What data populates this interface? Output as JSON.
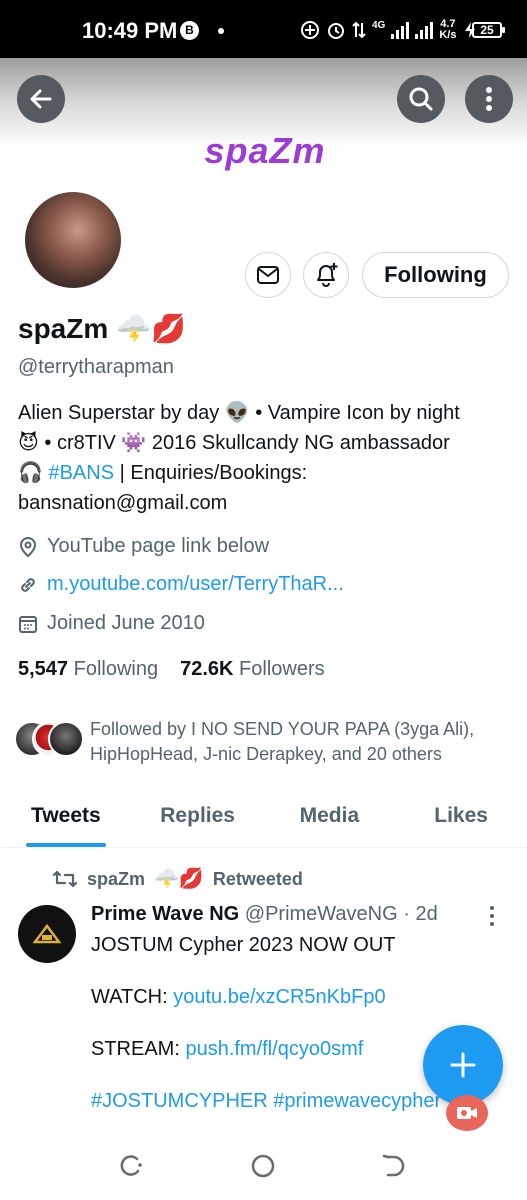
{
  "status_bar": {
    "time": "10:49 PM",
    "b_icon": "B",
    "network": "4G",
    "net_speed_value": "4.7",
    "net_speed_unit": "K/s",
    "battery": "25"
  },
  "header": {
    "brand_text": "spaZm"
  },
  "profile": {
    "name": "spaZm",
    "name_emojis": "🌩️💋",
    "handle": "@terrytharapman",
    "bio_parts": {
      "p1": "Alien Superstar by day 👽 • Vampire Icon by night 😈 • cr8TIV 👾  2016 Skullcandy NG ambassador 🎧 ",
      "hashtag": "#BANS",
      "p2": " | Enquiries/Bookings: bansnation@gmail.com"
    },
    "location": "YouTube page link below",
    "url": "m.youtube.com/user/TerryThaR...",
    "joined": "Joined June 2010",
    "following_count": "5,547",
    "following_label": "Following",
    "followers_count": "72.6K",
    "followers_label": "Followers",
    "followed_by": "Followed by I NO SEND YOUR PAPA (3yga Ali), HipHopHead, J-nic Derapkey, and 20 others",
    "follow_button_label": "Following"
  },
  "tabs": [
    {
      "label": "Tweets",
      "active": true
    },
    {
      "label": "Replies",
      "active": false
    },
    {
      "label": "Media",
      "active": false
    },
    {
      "label": "Likes",
      "active": false
    }
  ],
  "tweet": {
    "retweet_user": "spaZm",
    "retweet_emojis": "🌩️💋",
    "retweet_label": "Retweeted",
    "author_name": "Prime Wave NG",
    "author_handle": "@PrimeWaveNG",
    "time_ago": "· 2d",
    "line1": "JOSTUM Cypher 2023 NOW OUT",
    "watch_label": "WATCH: ",
    "watch_link": "youtu.be/xzCR5nKbFp0",
    "stream_label": "STREAM: ",
    "stream_link": "push.fm/fl/qcyo0smf",
    "hashtags": "#JOSTUMCYPHER #primewavecypher"
  },
  "icons": {
    "back": "arrow-left-icon",
    "search": "search-icon",
    "more": "more-vertical-icon",
    "mail": "mail-icon",
    "notify": "bell-plus-icon",
    "location": "location-pin-icon",
    "link": "link-icon",
    "calendar": "calendar-icon",
    "retweet": "retweet-icon",
    "compose": "plus-icon"
  },
  "colors": {
    "accent": "#1d9bf0",
    "brand": "#9c3cd4",
    "secondary_text": "#536471"
  }
}
